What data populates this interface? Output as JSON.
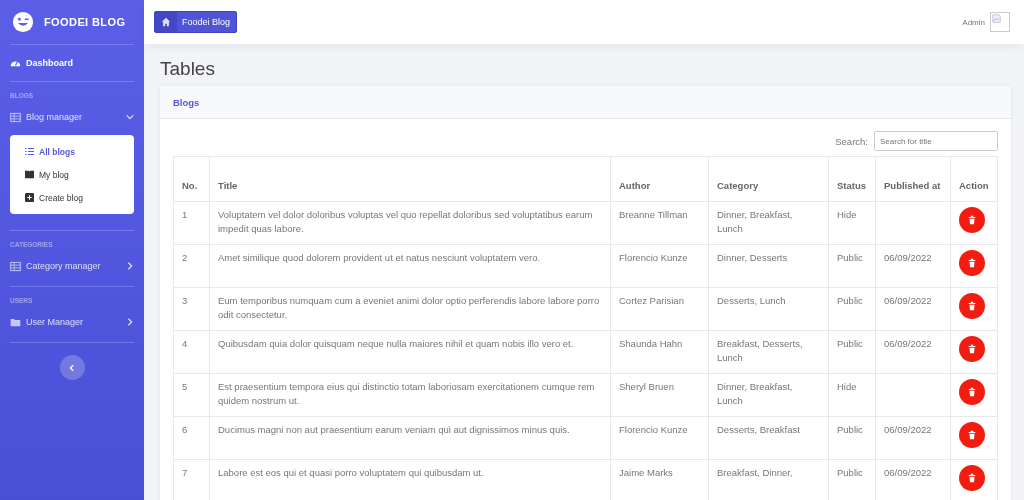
{
  "sidebar": {
    "brand": "FOODEI BLOG",
    "items": [
      {
        "kind": "link",
        "label": "Dashboard",
        "selected": true
      },
      {
        "kind": "heading",
        "label": "BLOGS"
      },
      {
        "kind": "group",
        "label": "Blog manager",
        "expanded": true,
        "children": [
          {
            "label": "All blogs",
            "selected": true
          },
          {
            "label": "My blog",
            "selected": false
          },
          {
            "label": "Create blog",
            "selected": false
          }
        ]
      },
      {
        "kind": "heading",
        "label": "CATEGORIES"
      },
      {
        "kind": "group",
        "label": "Category manager",
        "expanded": false
      },
      {
        "kind": "heading",
        "label": "USERS"
      },
      {
        "kind": "group",
        "label": "User Manager",
        "expanded": false
      }
    ]
  },
  "header": {
    "breadcrumb": "Foodei Blog",
    "user": "Admin"
  },
  "page_title": "Tables",
  "card": {
    "title": "Blogs",
    "search": {
      "label": "Search:",
      "placeholder": "Search for title"
    }
  },
  "table": {
    "columns": [
      "No.",
      "Title",
      "Author",
      "Category",
      "Status",
      "Published at",
      "Action"
    ],
    "rows": [
      {
        "no": "1",
        "title": "Voluptatem vel dolor doloribus voluptas vel quo repellat doloribus sed voluptatibus earum impedit quas labore.",
        "author": "Breanne Tillman",
        "category": "Dinner, Breakfast, Lunch",
        "status": "Hide",
        "published": ""
      },
      {
        "no": "2",
        "title": "Amet similique quod dolorem provident ut et natus nesciunt voluptatem vero.",
        "author": "Florencio Kunze",
        "category": "Dinner, Desserts",
        "status": "Public",
        "published": "06/09/2022"
      },
      {
        "no": "3",
        "title": "Eum temporibus numquam cum a eveniet animi dolor optio perferendis labore labore porro odit consectetur.",
        "author": "Cortez Parisian",
        "category": "Desserts, Lunch",
        "status": "Public",
        "published": "06/09/2022"
      },
      {
        "no": "4",
        "title": "Quibusdam quia dolor quisquam neque nulla maiores nihil et quam nobis illo vero et.",
        "author": "Shaunda Hahn",
        "category": "Breakfast, Desserts, Lunch",
        "status": "Public",
        "published": "06/09/2022"
      },
      {
        "no": "5",
        "title": "Est praesentium tempora eius qui distinctio totam laboriosam exercitationem cumque rem quidem nostrum ut.",
        "author": "Sheryl Bruen",
        "category": "Dinner, Breakfast, Lunch",
        "status": "Hide",
        "published": ""
      },
      {
        "no": "6",
        "title": "Ducimus magni non aut praesentium earum veniam qui aut dignissimos minus quis.",
        "author": "Florencio Kunze",
        "category": "Desserts, Breakfast",
        "status": "Public",
        "published": "06/09/2022"
      },
      {
        "no": "7",
        "title": "Labore est eos qui et quasi porro voluptatem qui quibusdam ut.",
        "author": "Jaime Marks",
        "category": "Breakfast, Dinner,",
        "status": "Public",
        "published": "06/09/2022"
      }
    ]
  }
}
